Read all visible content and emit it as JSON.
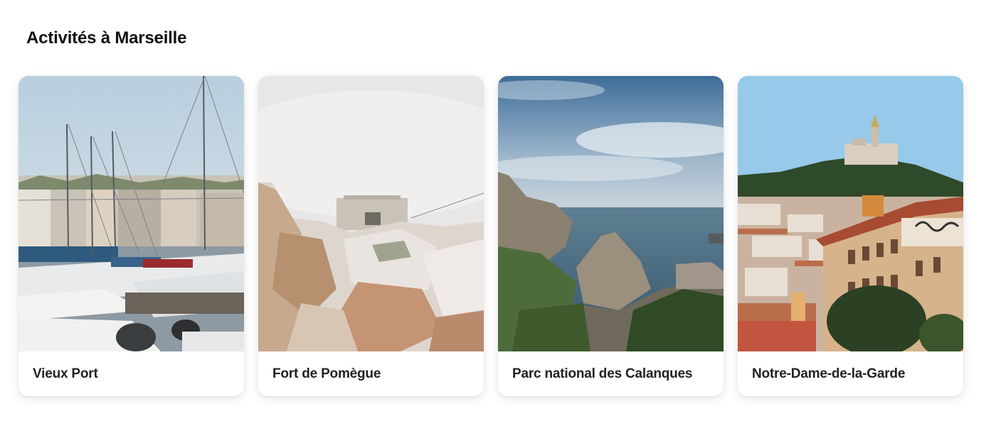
{
  "section": {
    "title": "Activités à Marseille"
  },
  "cards": [
    {
      "label": "Vieux Port"
    },
    {
      "label": "Fort de Pomègue"
    },
    {
      "label": "Parc national des Calanques"
    },
    {
      "label": "Notre-Dame-de-la-Garde"
    }
  ]
}
